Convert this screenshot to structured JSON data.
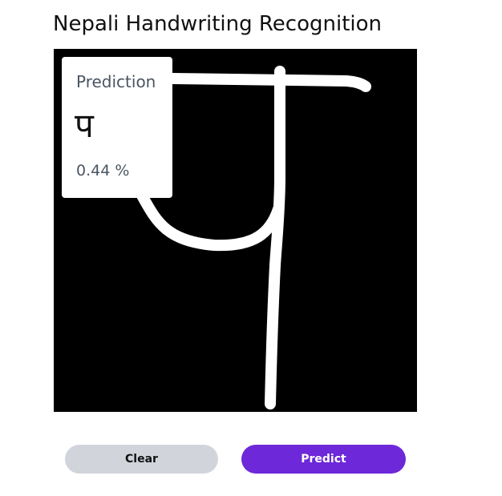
{
  "page": {
    "title": "Nepali Handwriting Recognition"
  },
  "drawing_canvas": {
    "background_color": "#000000",
    "stroke_color": "#ffffff"
  },
  "prediction": {
    "label": "Prediction",
    "character": "प",
    "confidence": "0.44 %"
  },
  "actions": {
    "clear_label": "Clear",
    "predict_label": "Predict",
    "clear_color": "#d1d5db",
    "predict_color": "#6d28d9"
  }
}
